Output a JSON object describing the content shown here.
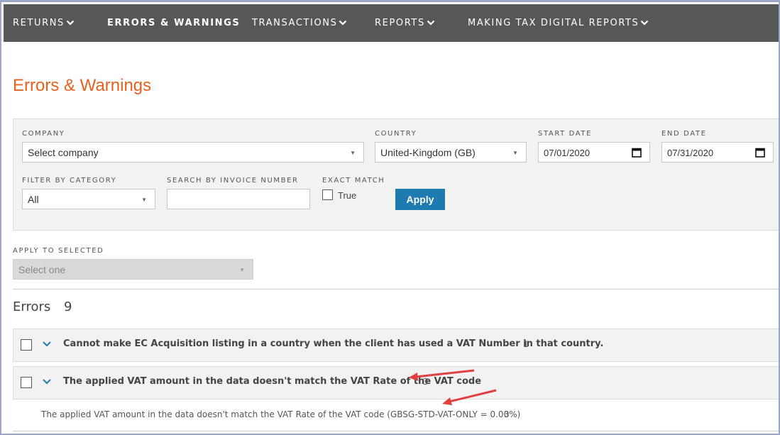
{
  "nav": {
    "items": [
      {
        "label": "RETURNS",
        "has_dropdown": true,
        "active": false
      },
      {
        "label": "ERRORS & WARNINGS",
        "has_dropdown": false,
        "active": true
      },
      {
        "label": "TRANSACTIONS",
        "has_dropdown": true,
        "active": false
      },
      {
        "label": "REPORTS",
        "has_dropdown": true,
        "active": false
      },
      {
        "label": "MAKING TAX DIGITAL REPORTS",
        "has_dropdown": true,
        "active": false
      }
    ]
  },
  "page": {
    "title": "Errors & Warnings"
  },
  "filters": {
    "company_label": "COMPANY",
    "company_value": "Select company",
    "country_label": "COUNTRY",
    "country_value": "United-Kingdom (GB)",
    "start_date_label": "START DATE",
    "start_date_value": "07/01/2020",
    "end_date_label": "END DATE",
    "end_date_value": "07/31/2020",
    "category_label": "FILTER BY CATEGORY",
    "category_value": "All",
    "invoice_search_label": "SEARCH BY INVOICE NUMBER",
    "invoice_search_value": "",
    "exact_match_label": "EXACT MATCH",
    "exact_match_option": "True",
    "exact_match_checked": false,
    "apply_label": "Apply"
  },
  "bulk_action": {
    "label": "APPLY TO SELECTED",
    "value": "Select one"
  },
  "errors": {
    "heading": "Errors",
    "count": "9",
    "rows": [
      {
        "text": "Cannot make EC Acquisition listing in a country when the client has used a VAT Number in that country.",
        "count": "1"
      },
      {
        "text": "The applied VAT amount in the data doesn't match the VAT Rate of the VAT code",
        "count": "3"
      }
    ],
    "detail": {
      "text": "The applied VAT amount in the data doesn't match the VAT Rate of the VAT code (GBSG-STD-VAT-ONLY = 0.00%)",
      "count": "3"
    }
  },
  "colors": {
    "nav_bg": "#575757",
    "title": "#e8611f",
    "apply_button": "#1e7bb0",
    "chevron": "#1e7bb0",
    "annotation_arrow": "#e0403f"
  }
}
